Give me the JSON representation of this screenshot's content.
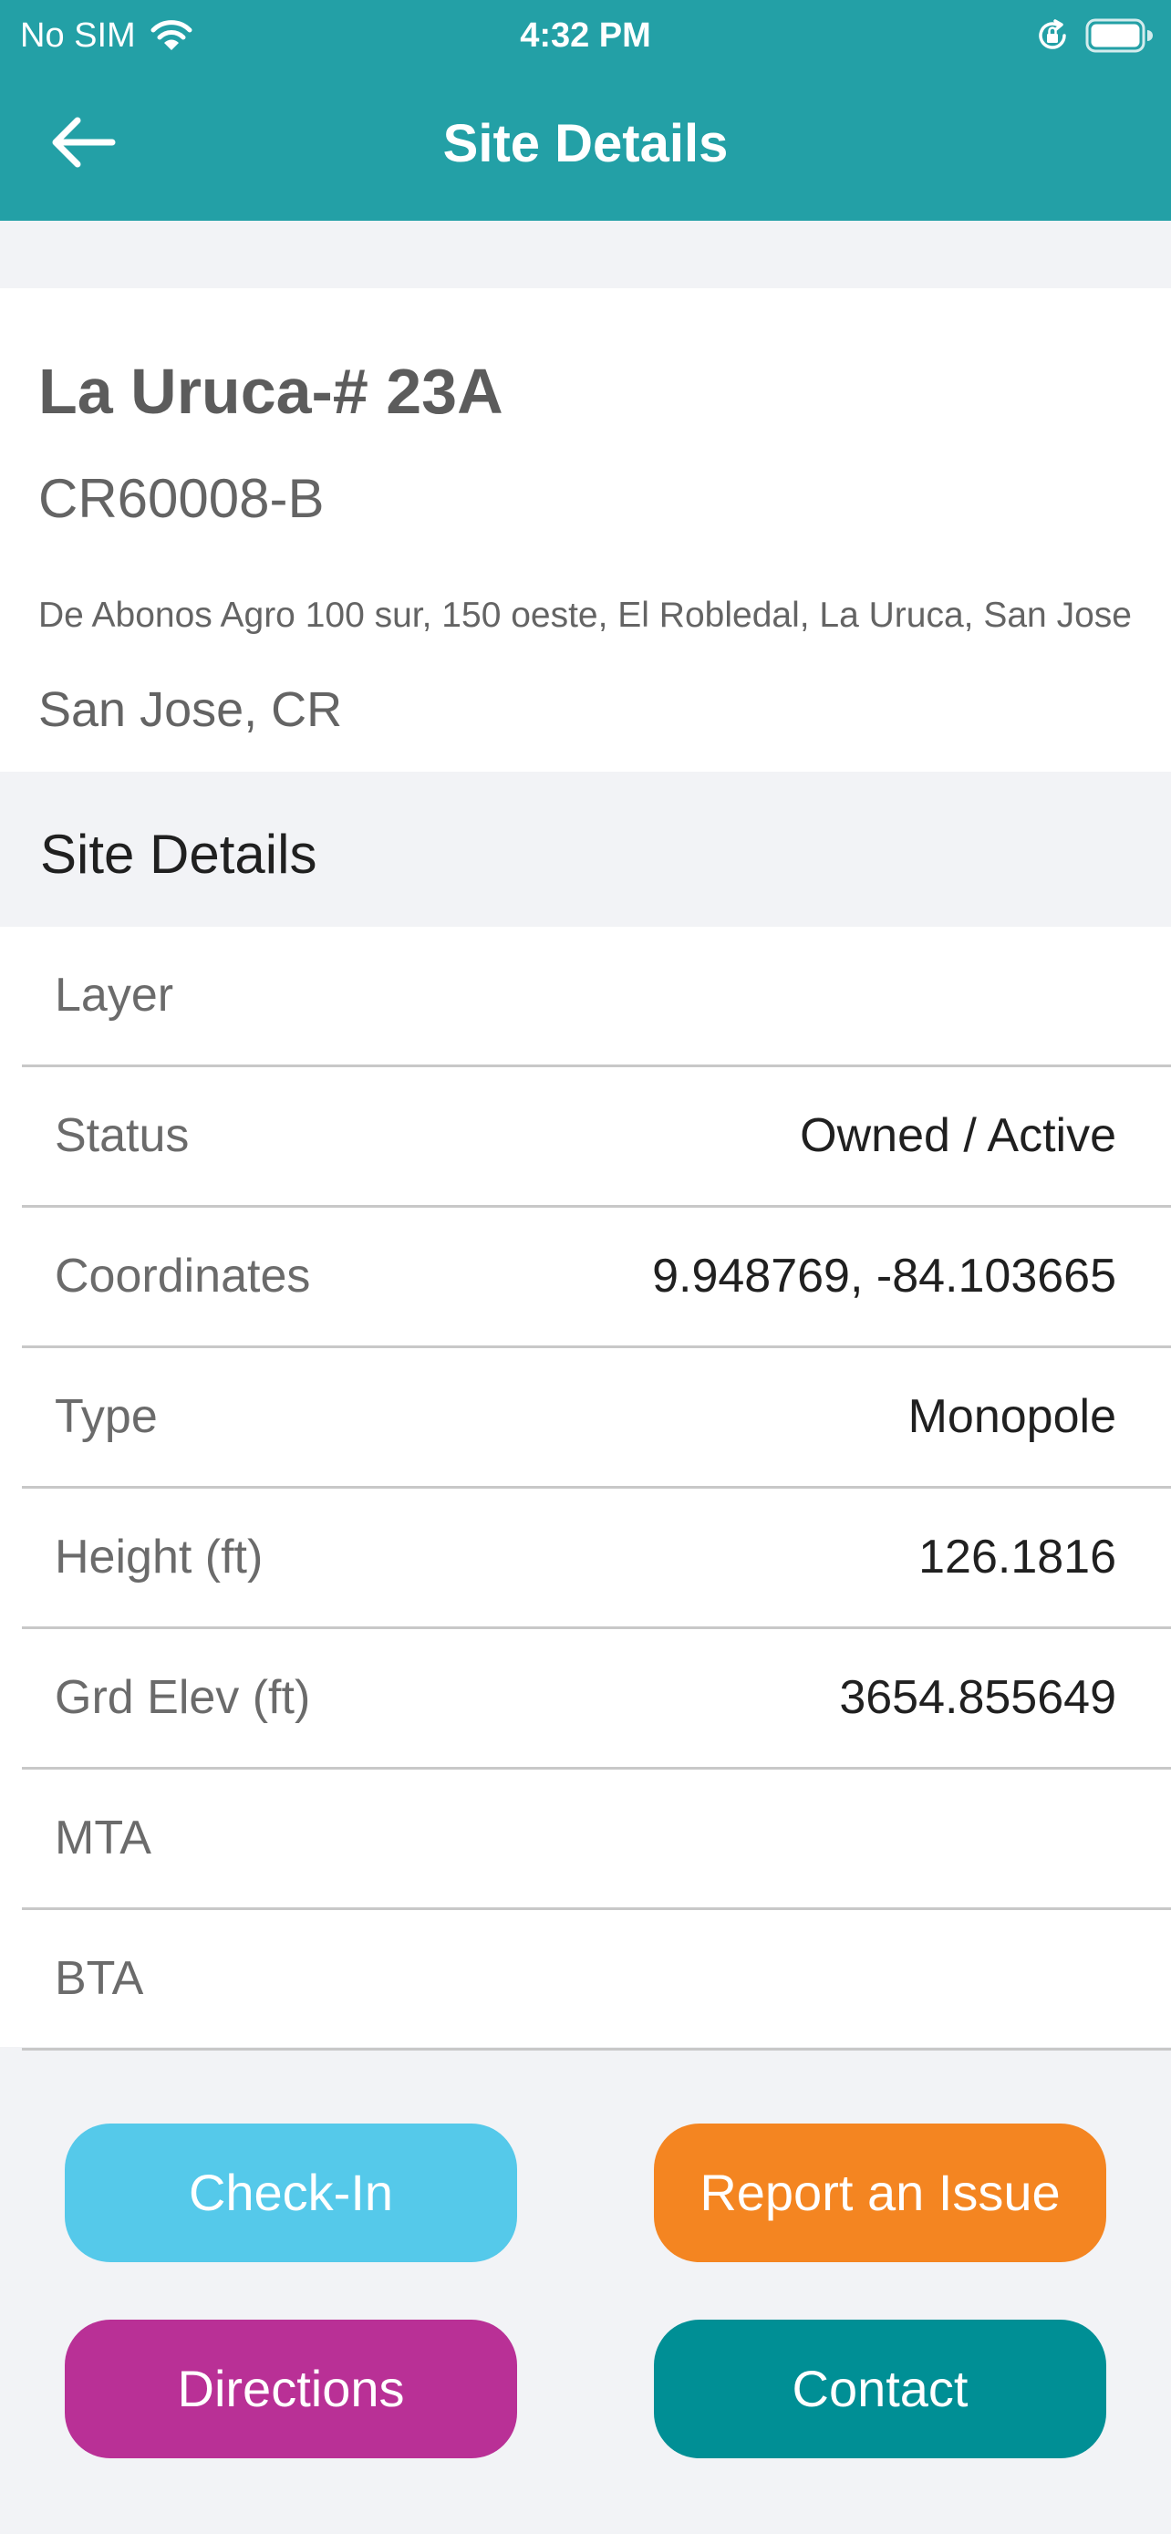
{
  "status_bar": {
    "carrier": "No SIM",
    "time": "4:32 PM"
  },
  "nav": {
    "title": "Site Details"
  },
  "site": {
    "name": "La Uruca-# 23A",
    "code": "CR60008-B",
    "address": "De Abonos Agro 100 sur, 150 oeste, El Robledal, La Uruca, San Jose",
    "city": "San Jose, CR"
  },
  "details": {
    "section_title": "Site Details",
    "rows": [
      {
        "label": "Layer",
        "value": ""
      },
      {
        "label": "Status",
        "value": "Owned / Active"
      },
      {
        "label": "Coordinates",
        "value": "9.948769, -84.103665"
      },
      {
        "label": "Type",
        "value": "Monopole"
      },
      {
        "label": "Height (ft)",
        "value": "126.1816"
      },
      {
        "label": "Grd Elev (ft)",
        "value": "3654.855649"
      },
      {
        "label": "MTA",
        "value": ""
      },
      {
        "label": "BTA",
        "value": ""
      }
    ]
  },
  "actions": {
    "check_in": "Check-In",
    "report_issue": "Report an Issue",
    "directions": "Directions",
    "contact": "Contact"
  },
  "colors": {
    "header": "#23a0a6",
    "check_in": "#55c9ea",
    "report_issue": "#f48521",
    "directions": "#b93096",
    "contact": "#008f95"
  },
  "icons": {
    "back": "arrow-left-icon",
    "wifi": "wifi-icon",
    "orientation_lock": "orientation-lock-icon",
    "battery": "battery-icon"
  }
}
